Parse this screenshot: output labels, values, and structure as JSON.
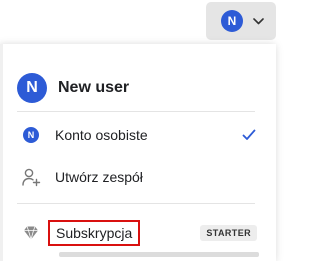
{
  "avatar_button": {
    "initial": "N"
  },
  "user": {
    "initial": "N",
    "name": "New user"
  },
  "menu": {
    "personal_account": {
      "initial": "N",
      "label": "Konto osobiste",
      "selected": true
    },
    "create_team": {
      "label": "Utwórz zespół"
    },
    "subscription": {
      "label": "Subskrypcja",
      "badge": "STARTER"
    }
  },
  "colors": {
    "avatar_blue": "#2d5bd6",
    "check_blue": "#2d5bd6",
    "highlight_red": "#d9100f",
    "badge_bg": "#ededed"
  },
  "icons": {
    "chevron": "chevron-down-icon",
    "create_team": "user-plus-icon",
    "subscription": "diamond-icon",
    "selected": "check-icon"
  }
}
